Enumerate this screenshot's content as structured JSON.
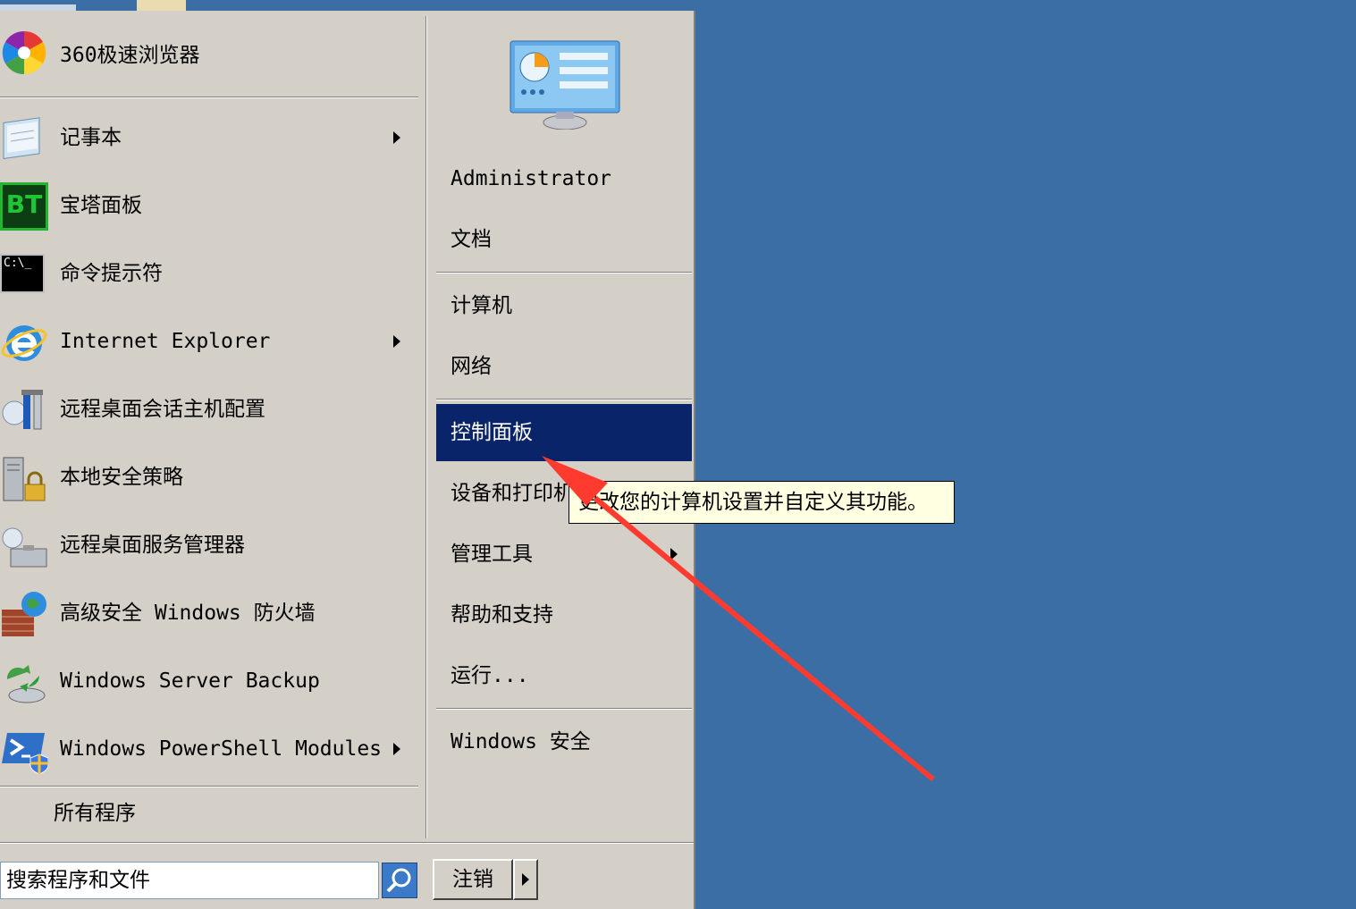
{
  "left_pane": {
    "pinned": [
      {
        "label": "360极速浏览器",
        "icon": "browser-360-icon",
        "has_submenu": false
      }
    ],
    "recent": [
      {
        "label": "记事本",
        "icon": "notepad-icon",
        "has_submenu": true
      },
      {
        "label": "宝塔面板",
        "icon": "bt-panel-icon",
        "icon_text": "BT",
        "has_submenu": false
      },
      {
        "label": "命令提示符",
        "icon": "command-prompt-icon",
        "icon_text": "C:\\_",
        "has_submenu": false
      },
      {
        "label": "Internet Explorer",
        "icon": "internet-explorer-icon",
        "has_submenu": true
      },
      {
        "label": "远程桌面会话主机配置",
        "icon": "remote-desktop-config-icon",
        "has_submenu": false
      },
      {
        "label": "本地安全策略",
        "icon": "local-security-policy-icon",
        "has_submenu": false
      },
      {
        "label": "远程桌面服务管理器",
        "icon": "remote-desktop-manager-icon",
        "has_submenu": false
      },
      {
        "label": "高级安全 Windows 防火墙",
        "icon": "firewall-icon",
        "has_submenu": false
      },
      {
        "label": "Windows Server Backup",
        "icon": "server-backup-icon",
        "has_submenu": false
      },
      {
        "label": "Windows PowerShell Modules",
        "icon": "powershell-icon",
        "has_submenu": true
      }
    ],
    "all_programs": "所有程序"
  },
  "right_pane": {
    "user_picture_icon": "control-panel-user-icon",
    "items": [
      {
        "label": "Administrator",
        "has_submenu": false
      },
      {
        "label": "文档",
        "has_submenu": false
      },
      {
        "label": "计算机",
        "has_submenu": false
      },
      {
        "label": "网络",
        "has_submenu": false
      },
      {
        "label": "控制面板",
        "has_submenu": false,
        "selected": true
      },
      {
        "label": "设备和打印机",
        "has_submenu": false
      },
      {
        "label": "管理工具",
        "has_submenu": true
      },
      {
        "label": "帮助和支持",
        "has_submenu": false
      },
      {
        "label": "运行...",
        "has_submenu": false
      },
      {
        "label": "Windows 安全",
        "has_submenu": false
      }
    ]
  },
  "bottom": {
    "search_value": "搜索程序和文件",
    "search_icon": "search-icon",
    "logoff_label": "注销",
    "logoff_arrow_icon": "chevron-right-icon"
  },
  "tooltip": {
    "text": "更改您的计算机设置并自定义其功能。"
  },
  "colors": {
    "desktop": "#3a6ea5",
    "menu_bg": "#d4d0c8",
    "selection": "#0a246a",
    "tooltip_bg": "#ffffe1",
    "annotation_arrow": "#ff3b30"
  }
}
